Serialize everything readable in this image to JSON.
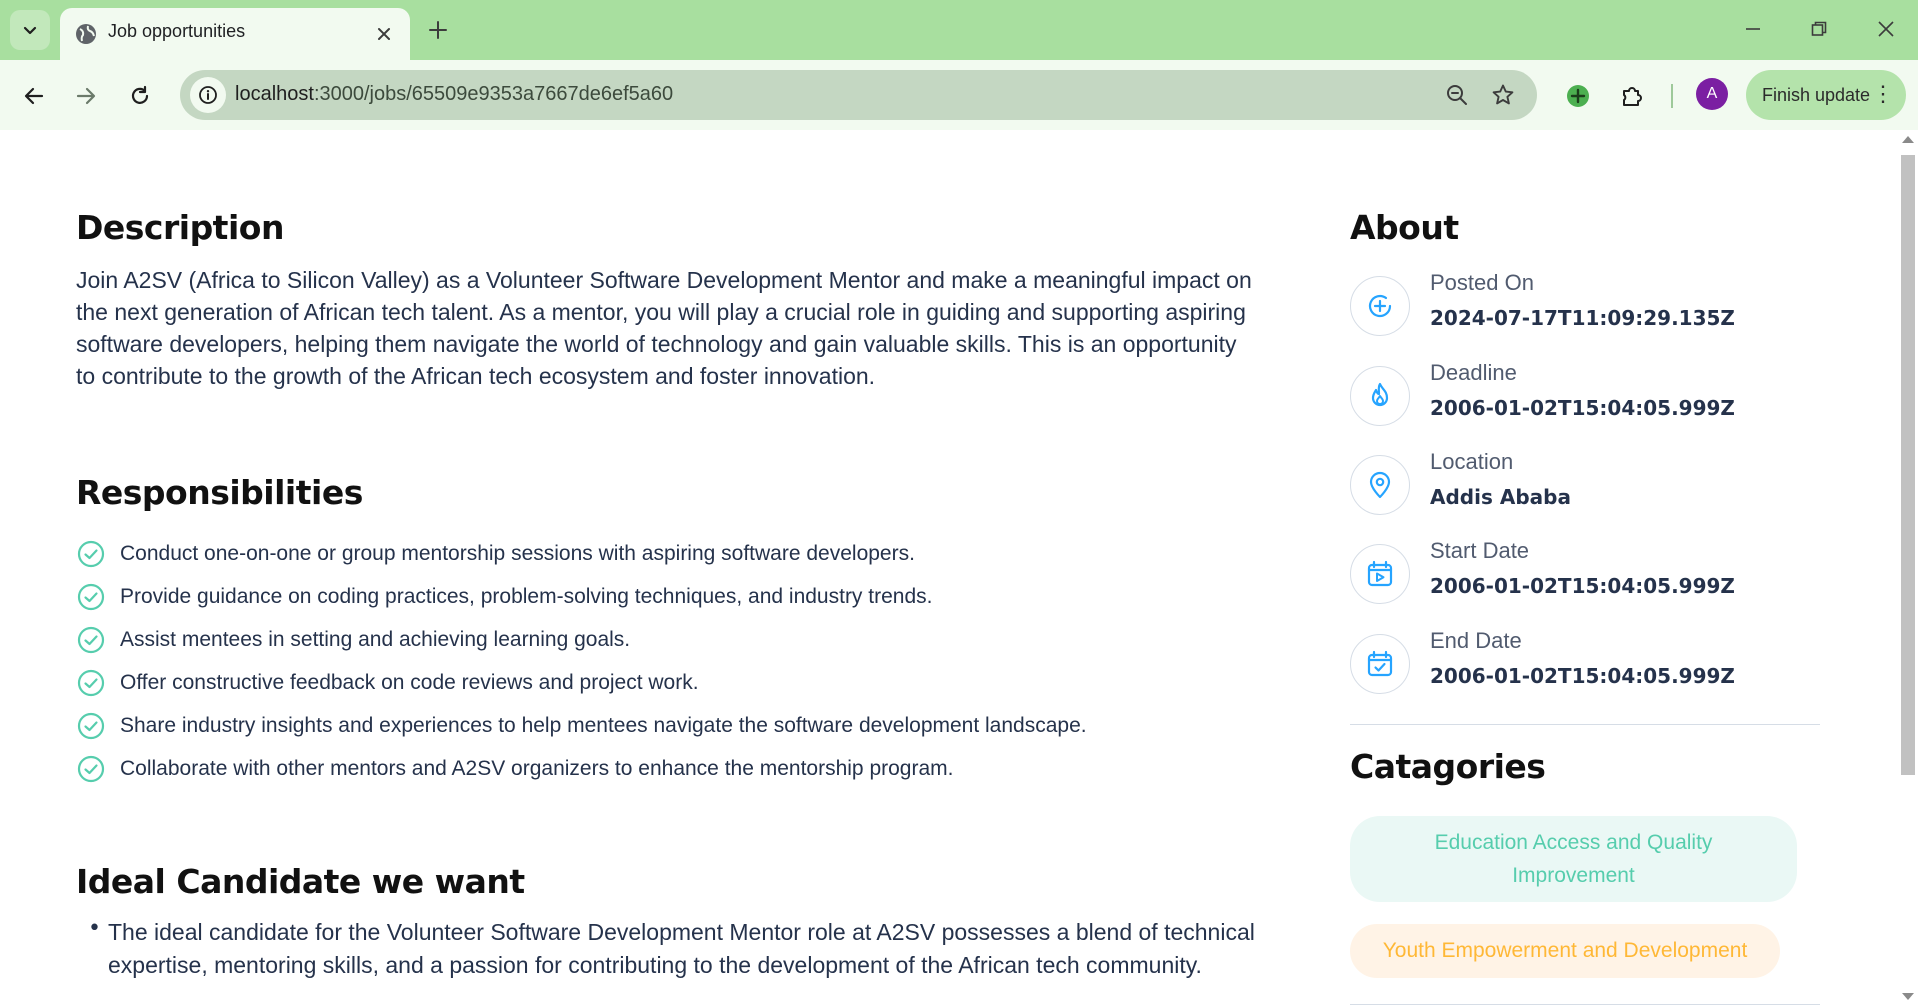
{
  "browser": {
    "tab_title": "Job opportunities",
    "url_host": "localhost",
    "url_path": ":3000/jobs/65509e9353a7667de6ef5a60",
    "finish_update_label": "Finish update",
    "profile_initial": "A"
  },
  "description": {
    "heading": "Description",
    "text": "Join A2SV (Africa to Silicon Valley) as a Volunteer Software Development Mentor and make a meaningful impact on the next generation of African tech talent. As a mentor, you will play a crucial role in guiding and supporting aspiring software developers, helping them navigate the world of technology and gain valuable skills. This is an opportunity to contribute to the growth of the African tech ecosystem and foster innovation."
  },
  "responsibilities": {
    "heading": "Responsibilities",
    "items": [
      "Conduct one-on-one or group mentorship sessions with aspiring software developers.",
      "Provide guidance on coding practices, problem-solving techniques, and industry trends.",
      "Assist mentees in setting and achieving learning goals.",
      "Offer constructive feedback on code reviews and project work.",
      "Share industry insights and experiences to help mentees navigate the software development landscape.",
      "Collaborate with other mentors and A2SV organizers to enhance the mentorship program."
    ]
  },
  "ideal_candidate": {
    "heading": "Ideal Candidate we want",
    "items": [
      "The ideal candidate for the Volunteer Software Development Mentor role at A2SV possesses a blend of technical expertise, mentoring skills, and a passion for contributing to the development of the African tech community."
    ]
  },
  "about": {
    "heading": "About",
    "items": [
      {
        "label": "Posted On",
        "value": "2024-07-17T11:09:29.135Z",
        "icon": "plus-circle-icon"
      },
      {
        "label": "Deadline",
        "value": "2006-01-02T15:04:05.999Z",
        "icon": "fire-icon"
      },
      {
        "label": "Location",
        "value": "Addis Ababa",
        "icon": "location-pin-icon"
      },
      {
        "label": "Start Date",
        "value": "2006-01-02T15:04:05.999Z",
        "icon": "calendar-play-icon"
      },
      {
        "label": "End Date",
        "value": "2006-01-02T15:04:05.999Z",
        "icon": "calendar-check-icon"
      }
    ]
  },
  "categories": {
    "heading": "Catagories",
    "items": [
      {
        "label": "Education Access and Quality Improvement",
        "color": "#56cdad",
        "bg": "#eaf8f5"
      },
      {
        "label": "Youth Empowerment and Development",
        "color": "#ffb836",
        "bg": "#fff3e6"
      }
    ]
  },
  "colors": {
    "chrome": "#a8df9f",
    "accent_icon": "#26a4ff",
    "check": "#56cdad",
    "text": "#25324b"
  }
}
